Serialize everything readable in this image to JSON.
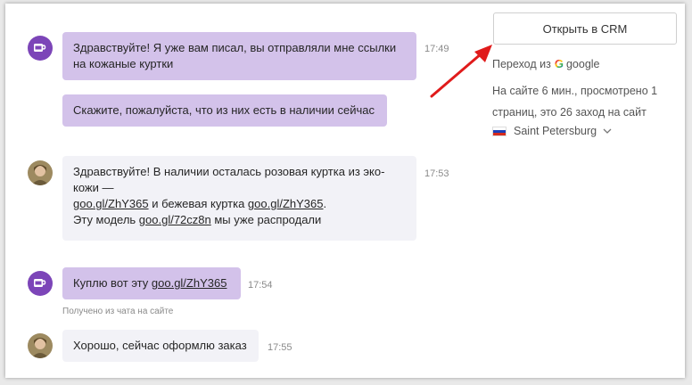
{
  "messages": [
    {
      "lines": [
        "Здравствуйте! Я уже вам писал, вы отправляли мне ссылки",
        "на кожаные куртки"
      ],
      "time": "17:49"
    },
    {
      "lines": [
        "Скажите, пожалуйста, что из них есть в наличии сейчас"
      ]
    },
    {
      "line1": "Здравствуйте! В наличии осталась розовая куртка из эко-",
      "line2": "кожи —",
      "link1": "goo.gl/ZhY365",
      "mid": " и бежевая куртка ",
      "link2": "goo.gl/ZhY365",
      "dot": ".",
      "pre3": "Эту модель ",
      "link3": "goo.gl/72cz8n",
      "post3": " мы уже распродали",
      "time": "17:53"
    },
    {
      "pre": "Куплю вот эту ",
      "link": "goo.gl/ZhY365",
      "time": "17:54",
      "note": "Получено из чата на сайте"
    },
    {
      "text": "Хорошо, сейчас оформлю заказ",
      "time": "17:55"
    }
  ],
  "sidebar": {
    "crm_button": "Открыть в CRM",
    "referrer_prefix": "Переход из",
    "referrer": "google",
    "stats_line1": "На сайте 6 мин., просмотрено 1",
    "stats_line2": "страниц, это 26 заход на сайт",
    "city": "Saint Petersburg"
  },
  "colors": {
    "operator_avatar": "#7c45b8",
    "operator_bubble": "#d3c2ea",
    "user_bubble": "#f2f2f7",
    "arrow": "#e01b1b"
  },
  "icons": {
    "operator": "cup-icon",
    "referrer": "google-icon",
    "location": "russia-flag-icon",
    "dropdown": "chevron-down-icon"
  }
}
